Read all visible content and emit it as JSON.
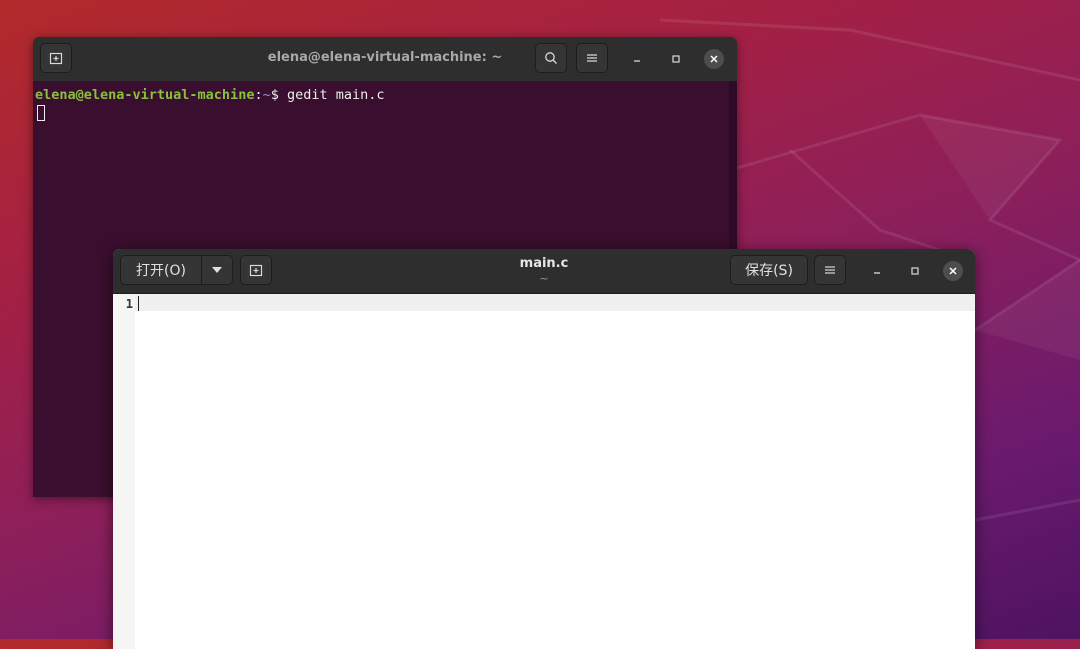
{
  "terminal": {
    "title": "elena@elena-virtual-machine: ~",
    "prompt_user": "elena@elena-virtual-machine",
    "prompt_sep": ":",
    "prompt_path": "~",
    "prompt_symbol": "$ ",
    "command": "gedit main.c",
    "icons": [
      "new-tab-icon",
      "search-icon",
      "menu-icon",
      "minimize-icon",
      "maximize-icon",
      "close-icon"
    ]
  },
  "gedit": {
    "open_label": "打开(O)",
    "save_label": "保存(S)",
    "title": "main.c",
    "subtitle": "~",
    "line_numbers": [
      "1"
    ],
    "icons": [
      "dropdown-arrow-icon",
      "new-document-icon",
      "menu-icon",
      "minimize-icon",
      "maximize-icon",
      "close-icon"
    ]
  },
  "colors": {
    "header_bg": "#2e2e2e",
    "terminal_bg": "#3a0e2e",
    "prompt_user": "#86c23a",
    "prompt_path": "#729fcf"
  }
}
